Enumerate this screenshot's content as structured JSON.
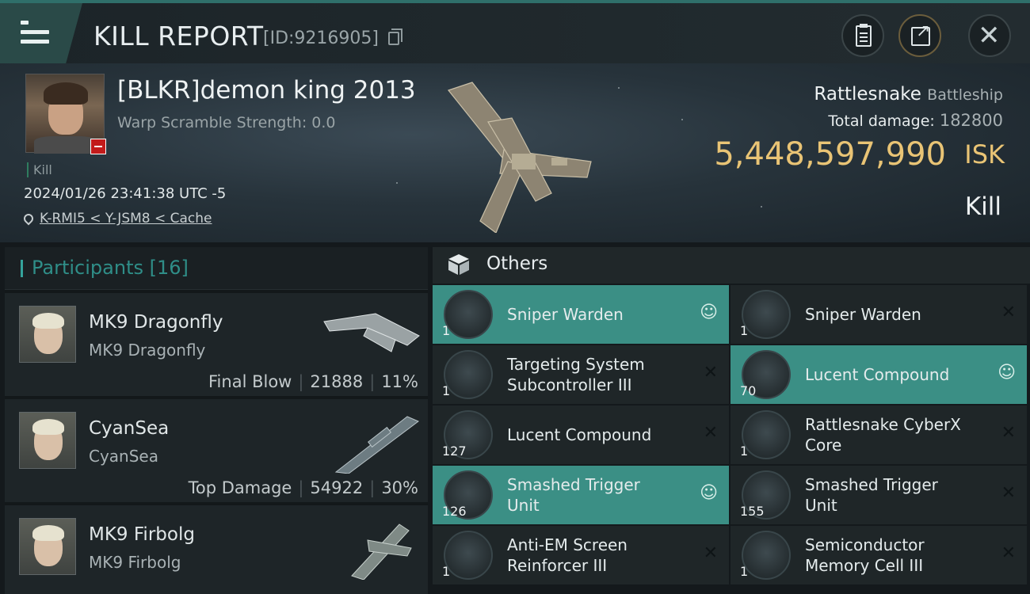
{
  "header": {
    "title": "KILL REPORT",
    "report_id": "[ID:9216905]"
  },
  "victim": {
    "name": "[BLKR]demon king 2013",
    "warp_scramble": "Warp Scramble Strength: 0.0",
    "tag": "Kill",
    "datetime": "2024/01/26 23:41:38 UTC -5",
    "location": "K-RMI5 < Y-JSM8 < Cache",
    "ship_name": "Rattlesnake",
    "ship_class": "Battleship",
    "total_damage_label": "Total damage:",
    "total_damage_value": "182800",
    "isk_value": "5,448,597,990",
    "isk_unit": "ISK",
    "result": "Kill"
  },
  "participants": {
    "label": "Participants [16]",
    "rows": [
      {
        "name": "MK9 Dragonfly",
        "ship": "MK9 Dragonfly",
        "stat_label": "Final Blow",
        "damage": "21888",
        "percent": "11%"
      },
      {
        "name": "CyanSea",
        "ship": "CyanSea",
        "stat_label": "Top Damage",
        "damage": "54922",
        "percent": "30%"
      },
      {
        "name": "MK9 Firbolg",
        "ship": "MK9 Firbolg",
        "stat_label": "",
        "damage": "",
        "percent": ""
      }
    ]
  },
  "others": {
    "title": "Others",
    "items": [
      {
        "qty": "1",
        "name_line1": "Sniper  Warden",
        "name_line2": "",
        "highlight": true,
        "action": "person"
      },
      {
        "qty": "1",
        "name_line1": "Sniper  Warden",
        "name_line2": "",
        "highlight": false,
        "action": "close"
      },
      {
        "qty": "1",
        "name_line1": "Targeting System",
        "name_line2": "Subcontroller III",
        "highlight": false,
        "action": "close"
      },
      {
        "qty": "70",
        "name_line1": "Lucent Compound",
        "name_line2": "",
        "highlight": true,
        "action": "person"
      },
      {
        "qty": "127",
        "name_line1": "Lucent Compound",
        "name_line2": "",
        "highlight": false,
        "action": "close"
      },
      {
        "qty": "1",
        "name_line1": "Rattlesnake CyberX",
        "name_line2": "Core",
        "highlight": false,
        "action": "close"
      },
      {
        "qty": "126",
        "name_line1": "Smashed Trigger",
        "name_line2": "Unit",
        "highlight": true,
        "action": "person"
      },
      {
        "qty": "155",
        "name_line1": "Smashed Trigger",
        "name_line2": "Unit",
        "highlight": false,
        "action": "close"
      },
      {
        "qty": "1",
        "name_line1": "Anti-EM Screen",
        "name_line2": "Reinforcer III",
        "highlight": false,
        "action": "close"
      },
      {
        "qty": "1",
        "name_line1": "Semiconductor",
        "name_line2": "Memory Cell III",
        "highlight": false,
        "action": "close"
      }
    ]
  },
  "icons": {
    "menu": "menu-icon",
    "copy": "copy-icon",
    "clipboard": "clipboard-icon",
    "share": "share-icon",
    "close": "close-icon",
    "pin": "location-pin-icon",
    "box": "cargo-box-icon",
    "person": "person-icon",
    "remove": "close-x-icon"
  },
  "colors": {
    "accent": "#34a39b",
    "highlight": "#3b8f85",
    "isk_gold": "#e9c475",
    "danger": "#c21b1b"
  }
}
